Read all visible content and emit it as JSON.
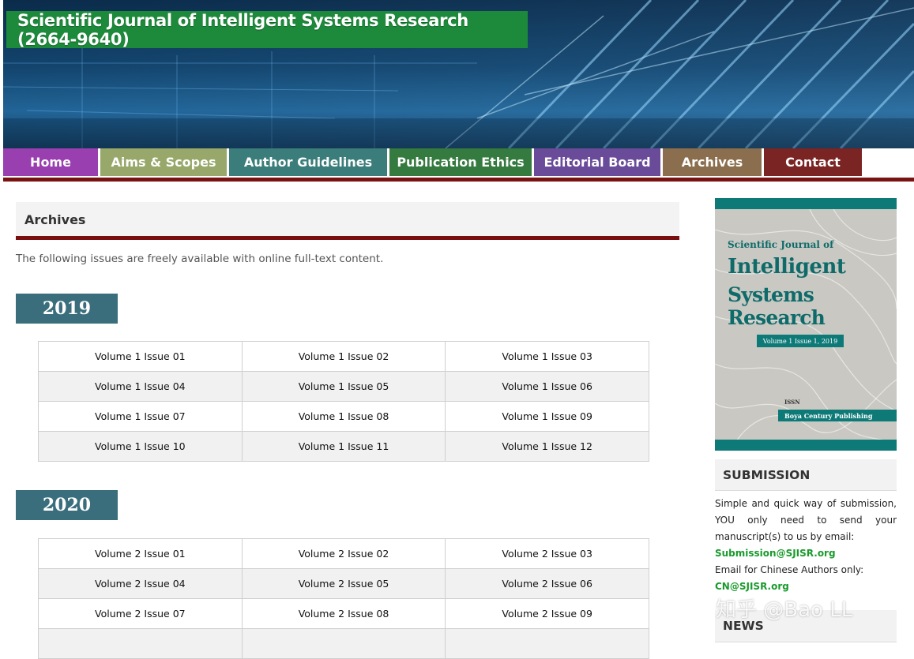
{
  "header": {
    "title": "Scientific Journal of Intelligent Systems Research (2664-9640)"
  },
  "nav": {
    "items": [
      {
        "label": "Home",
        "color": "#9a3fb0"
      },
      {
        "label": "Aims & Scopes",
        "color": "#97a86a"
      },
      {
        "label": "Author Guidelines",
        "color": "#3a7d7a"
      },
      {
        "label": "Publication Ethics",
        "color": "#357a3f"
      },
      {
        "label": "Editorial Board",
        "color": "#6a4b9a"
      },
      {
        "label": "Archives",
        "color": "#8a6e4d"
      },
      {
        "label": "Contact",
        "color": "#7a2424"
      }
    ]
  },
  "main": {
    "heading": "Archives",
    "intro": "The following issues are freely available with online full-text content.",
    "years": [
      {
        "year": "2019",
        "rows": [
          [
            "Volume 1 Issue 01",
            "Volume 1 Issue 02",
            "Volume 1 Issue 03"
          ],
          [
            "Volume 1 Issue 04",
            "Volume 1 Issue 05",
            "Volume 1 Issue 06"
          ],
          [
            "Volume 1 Issue 07",
            "Volume 1 Issue 08",
            "Volume 1 Issue 09"
          ],
          [
            "Volume 1 Issue 10",
            "Volume 1 Issue 11",
            "Volume 1 Issue 12"
          ]
        ]
      },
      {
        "year": "2020",
        "rows": [
          [
            "Volume 2 Issue 01",
            "Volume 2 Issue 02",
            "Volume 2 Issue 03"
          ],
          [
            "Volume 2 Issue 04",
            "Volume 2 Issue 05",
            "Volume 2 Issue 06"
          ],
          [
            "Volume 2 Issue 07",
            "Volume 2 Issue 08",
            "Volume 2 Issue 09"
          ],
          [
            "",
            "",
            ""
          ]
        ]
      }
    ]
  },
  "sidebar": {
    "cover": {
      "line1": "Scientific Journal of",
      "line2": "Intelligent",
      "line3": "Systems Research",
      "volume": "Volume 1 Issue 1, 2019",
      "issn": "ISSN",
      "publisher": "Boya Century Publishing"
    },
    "submission": {
      "heading": "SUBMISSION",
      "text": "Simple and quick way of submission, YOU only need to send your manuscript(s) to us by email:",
      "email": "Submission@SJISR.org",
      "chinese_text": "Email for Chinese Authors only:",
      "chinese_email": "CN@SJISR.org"
    },
    "news": {
      "heading": "NEWS"
    }
  },
  "watermark": "知乎 @Bao LL"
}
